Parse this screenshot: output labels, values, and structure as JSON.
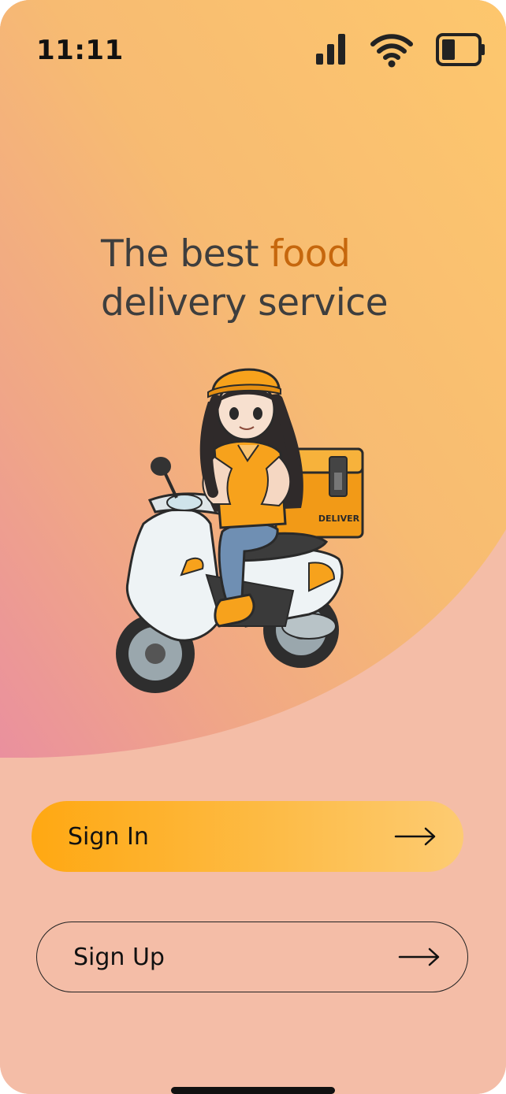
{
  "status_bar": {
    "time": "11:11",
    "icons": [
      "cellular-signal-icon",
      "wifi-icon",
      "battery-icon"
    ]
  },
  "hero": {
    "headline_part1": "The best ",
    "headline_accent": "food",
    "headline_part2": "delivery service",
    "illustration": "delivery-rider-on-scooter",
    "box_label": "DELIVER"
  },
  "actions": {
    "signin_label": "Sign In",
    "signup_label": "Sign Up",
    "arrow_icon": "arrow-right-icon"
  },
  "colors": {
    "accent_text": "#c6670d",
    "signin_gradient_start": "#ffa812",
    "signin_gradient_end": "#fdcb72",
    "background_bottom": "#f4bda7",
    "background_top": "#fdc76d"
  }
}
